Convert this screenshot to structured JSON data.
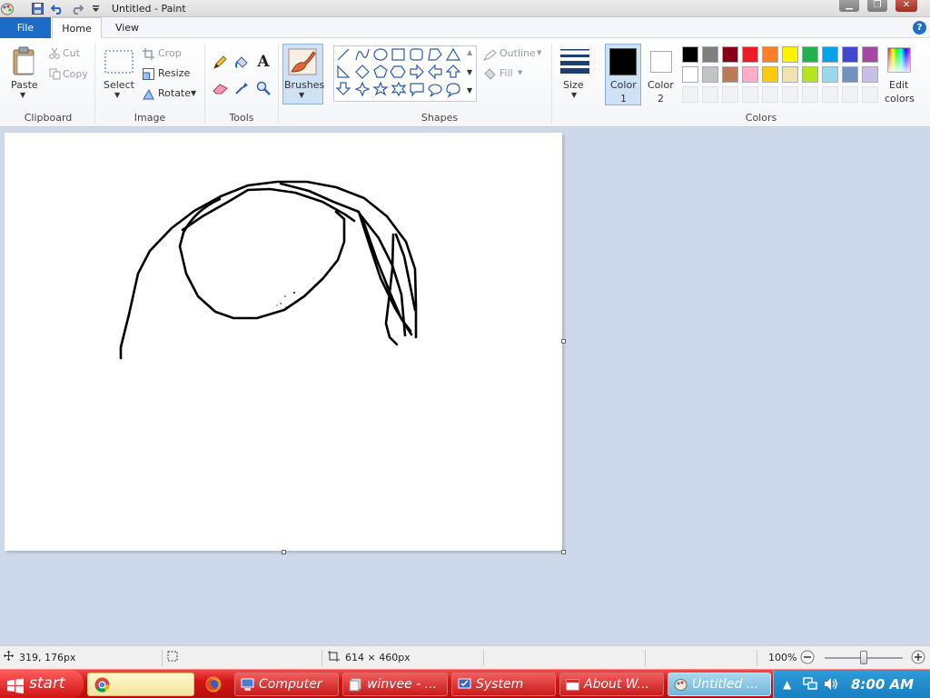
{
  "window": {
    "title": "Untitled - Paint"
  },
  "tabs": {
    "file": "File",
    "home": "Home",
    "view": "View"
  },
  "help": "?",
  "ribbon": {
    "clipboard": {
      "label": "Clipboard",
      "paste": "Paste",
      "cut": "Cut",
      "copy": "Copy"
    },
    "image": {
      "label": "Image",
      "select": "Select",
      "crop": "Crop",
      "resize": "Resize",
      "rotate": "Rotate"
    },
    "tools": {
      "label": "Tools"
    },
    "brushes": {
      "label": "Brushes"
    },
    "shapes": {
      "label": "Shapes",
      "outline": "Outline",
      "fill": "Fill"
    },
    "size": {
      "label": "Size"
    },
    "color1": {
      "line1": "Color",
      "line2": "1"
    },
    "color2": {
      "line1": "Color",
      "line2": "2"
    },
    "colors": {
      "label": "Colors",
      "edit_line1": "Edit",
      "edit_line2": "colors"
    },
    "palette_row1": [
      "#000000",
      "#7f7f7f",
      "#880015",
      "#ed1c24",
      "#ff7f27",
      "#fff200",
      "#22b14c",
      "#00a2e8",
      "#3f48cc",
      "#a349a4"
    ],
    "palette_row2": [
      "#ffffff",
      "#c3c3c3",
      "#b97a57",
      "#ffaec9",
      "#ffc90e",
      "#efe4b0",
      "#b5e61d",
      "#99d9ea",
      "#7092be",
      "#c8bfe7"
    ],
    "selected_color1": "#000000",
    "selected_color2": "#ffffff"
  },
  "status": {
    "cursor_pos": "319, 176px",
    "canvas_size": "614 × 460px",
    "zoom": "100%",
    "zoom_fraction": 0.5
  },
  "taskbar": {
    "start": "start",
    "items": [
      "Computer",
      "winvee - ...",
      "System",
      "About W...",
      "Untitled ..."
    ],
    "clock": "8:00 AM"
  }
}
